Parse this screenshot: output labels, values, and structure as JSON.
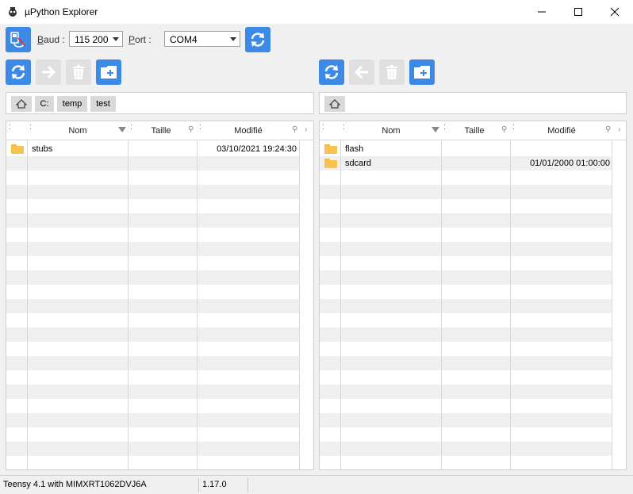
{
  "window": {
    "title": "µPython Explorer"
  },
  "toolbar": {
    "baud_label_key": "B",
    "baud_label_rest": "aud :",
    "baud_value": "115 200",
    "port_label_key": "P",
    "port_label_rest": "ort :",
    "port_value": "COM4"
  },
  "left": {
    "path": [
      "C:",
      "temp",
      "test"
    ],
    "columns": {
      "name": "Nom",
      "size": "Taille",
      "modified": "Modifié"
    },
    "rows": [
      {
        "name": "stubs",
        "size": "",
        "modified": "03/10/2021 19:24:30",
        "type": "folder"
      }
    ]
  },
  "right": {
    "path": [],
    "columns": {
      "name": "Nom",
      "size": "Taille",
      "modified": "Modifié"
    },
    "rows": [
      {
        "name": "flash",
        "size": "",
        "modified": "",
        "type": "folder"
      },
      {
        "name": "sdcard",
        "size": "",
        "modified": "01/01/2000 01:00:00",
        "type": "folder"
      }
    ]
  },
  "status": {
    "device": "Teensy 4.1 with MIMXRT1062DVJ6A",
    "version": "1.17.0"
  },
  "colors": {
    "accent": "#3c8ae6",
    "folder": "#f6c44f"
  }
}
